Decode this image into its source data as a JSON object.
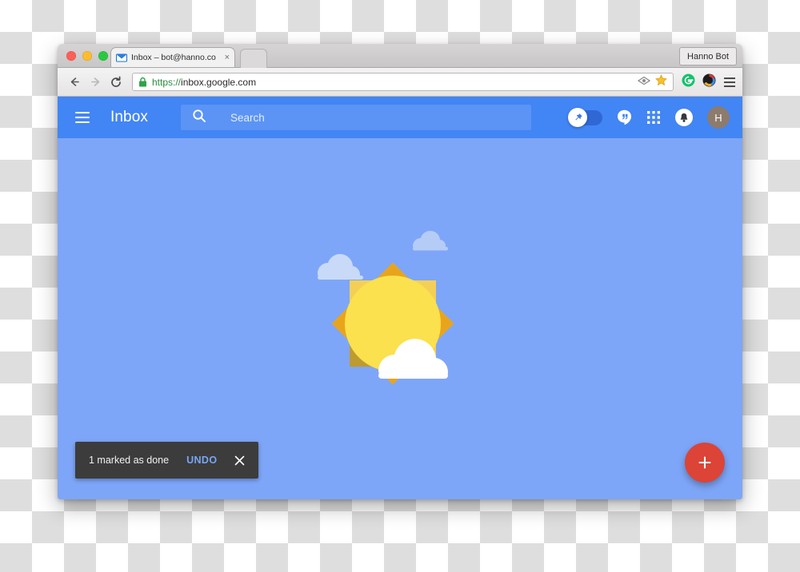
{
  "browser": {
    "tab": {
      "title": "Inbox – bot@hanno.co",
      "favicon": "envelope-icon",
      "close": "×"
    },
    "profile_button": "Hanno Bot",
    "toolbar": {
      "back": "←",
      "forward": "→",
      "reload": "↻",
      "lock": "lock-icon",
      "url_scheme": "https://",
      "url_host": "inbox.google.com",
      "omnibox_actions": [
        "cast-icon",
        "bookmark-star-icon"
      ],
      "extensions": [
        "grammarly-icon",
        "colorzilla-icon"
      ],
      "menu": "chrome-menu-icon"
    }
  },
  "app": {
    "menu_button": "hamburger-menu-icon",
    "title": "Inbox",
    "search": {
      "icon": "search-icon",
      "placeholder": "Search",
      "value": ""
    },
    "actions": {
      "pin_toggle": {
        "name": "pin-toggle",
        "state": "on",
        "icon": "pin-icon"
      },
      "hangouts": "hangouts-icon",
      "apps_grid": "apps-grid-icon",
      "notifications": "bell-icon",
      "avatar_initial": "H"
    }
  },
  "snackbar": {
    "message": "1 marked as done",
    "action": "UNDO",
    "close": "✕"
  },
  "fab": {
    "label": "+",
    "name": "compose-button"
  },
  "illustration": {
    "name": "sun-and-clouds-empty-state",
    "description": "Sun with clouds all-done illustration"
  },
  "colors": {
    "appbar_blue": "#4285f4",
    "canvas_blue": "#7ea6f8",
    "search_blue": "#5b94f5",
    "fab_red": "#db4437",
    "snackbar_dark": "#3c3c3c",
    "undo_blue": "#78a6f5",
    "sun_yellow": "#fbe14d",
    "sun_square_light": "#f4cf58",
    "sun_diamond_orange": "#e8a51c",
    "sun_shadow": "#9b7a1c",
    "cloud_white": "#ffffff",
    "cloud_pale": "#ccdcf8",
    "avatar_brown": "#8d7b6d",
    "lock_green": "#2c8a3e"
  }
}
